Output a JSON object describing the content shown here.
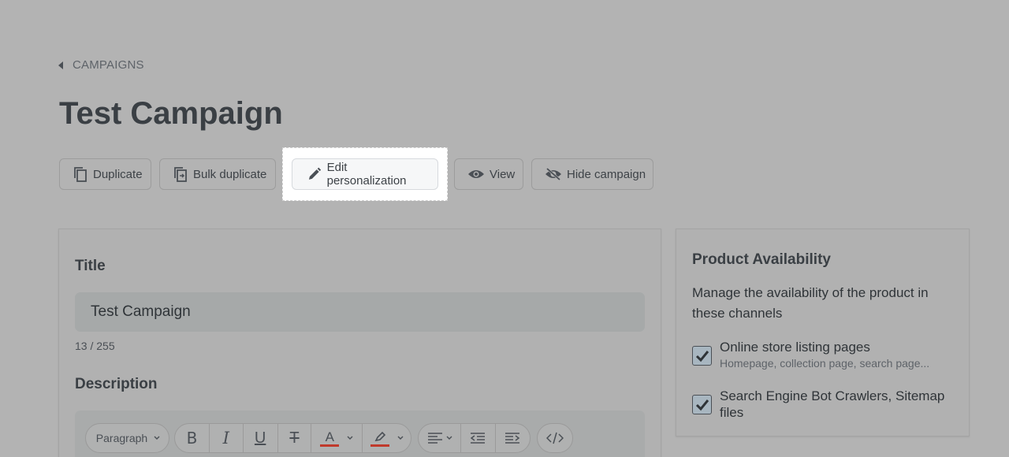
{
  "breadcrumb": {
    "label": "CAMPAIGNS"
  },
  "page": {
    "title": "Test Campaign"
  },
  "actions": {
    "duplicate": "Duplicate",
    "bulk_duplicate": "Bulk duplicate",
    "edit_personalization": "Edit personalization",
    "view": "View",
    "hide_campaign": "Hide campaign"
  },
  "form": {
    "title_label": "Title",
    "title_value": "Test Campaign",
    "title_counter": "13 / 255",
    "description_label": "Description",
    "toolbar": {
      "paragraph": "Paragraph",
      "bold_glyph": "B",
      "italic_glyph": "I",
      "underline_glyph": "U",
      "strike_glyph": "T",
      "text_color_glyph": "A",
      "text_color_hex": "#c0392b",
      "highlight_color_hex": "#c0392b"
    }
  },
  "availability": {
    "title": "Product Availability",
    "description": "Manage the availability of the product in these channels",
    "channels": [
      {
        "label": "Online store listing pages",
        "sublabel": "Homepage, collection page, search page...",
        "checked": true
      },
      {
        "label": "Search Engine Bot Crawlers, Sitemap files",
        "sublabel": "",
        "checked": true
      }
    ]
  }
}
